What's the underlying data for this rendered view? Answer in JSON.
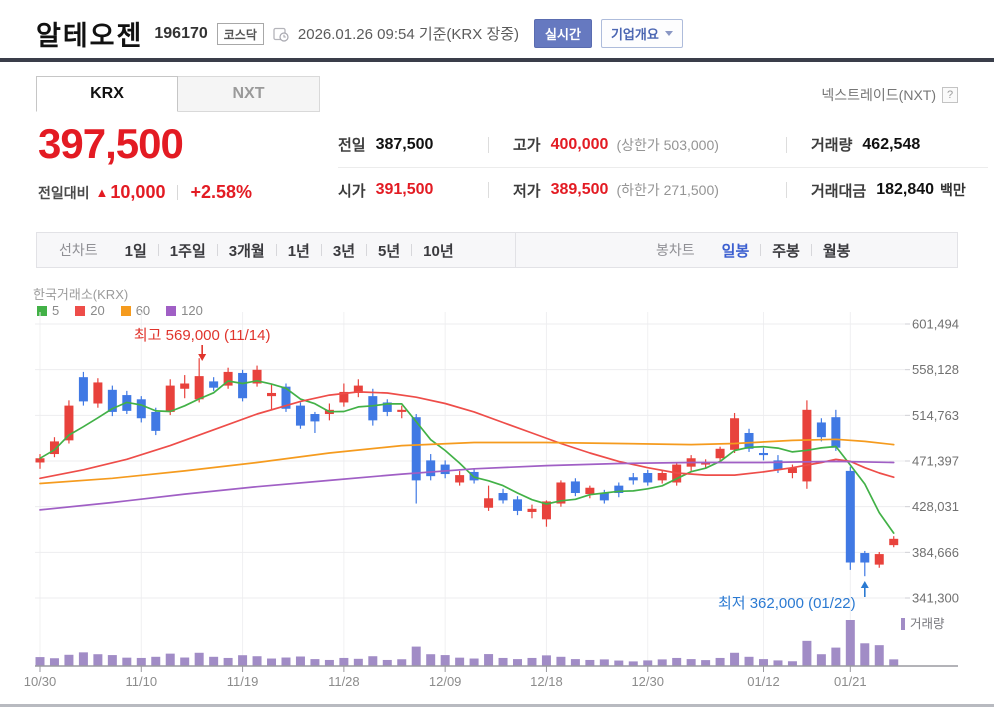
{
  "header": {
    "title": "알테오젠",
    "code": "196170",
    "market_badge": "코스닥",
    "datetime_note": "2026.01.26 09:54 기준(KRX 장중)",
    "realtime_button": "실시간",
    "company_overview_button": "기업개요",
    "nxt_link": "넥스트레이드(NXT)",
    "help_icon": "?"
  },
  "tabs": [
    {
      "label": "KRX",
      "active": true
    },
    {
      "label": "NXT",
      "active": false
    }
  ],
  "price": {
    "current": "397,500",
    "change_label": "전일대비",
    "change_direction": "up",
    "change_triangle": "▲",
    "change_value": "10,000",
    "change_percent": "+2.58%"
  },
  "info": {
    "prev_label": "전일",
    "prev": "387,500",
    "high_label": "고가",
    "high": "400,000",
    "upper_limit": "(상한가 503,000)",
    "volume_label": "거래량",
    "volume": "462,548",
    "open_label": "시가",
    "open": "391,500",
    "low_label": "저가",
    "low": "389,500",
    "lower_limit": "(하한가 271,500)",
    "value_label": "거래대금",
    "value": "182,840",
    "value_unit": "백만"
  },
  "toolbar": {
    "line_label": "선차트",
    "line_periods": [
      "1일",
      "1주일",
      "3개월",
      "1년",
      "3년",
      "5년",
      "10년"
    ],
    "candle_label": "봉차트",
    "candle_periods": [
      "일봉",
      "주봉",
      "월봉"
    ],
    "candle_active": "일봉"
  },
  "chart_data": {
    "type": "candlestick",
    "title": "한국거래소(KRX)",
    "price_unit_krw": 1000,
    "volume_unit_shares": 1000,
    "legend": [
      {
        "label": "5",
        "color": "#42b147"
      },
      {
        "label": "20",
        "color": "#ee4d49"
      },
      {
        "label": "60",
        "color": "#f59b1e"
      },
      {
        "label": "120",
        "color": "#a05fc5"
      }
    ],
    "volume_legend": "거래량",
    "y_ticks": [
      601494,
      558128,
      514763,
      471397,
      428031,
      384666,
      341300
    ],
    "x_ticks": [
      {
        "i": 0,
        "label": "10/30"
      },
      {
        "i": 7,
        "label": "11/10"
      },
      {
        "i": 14,
        "label": "11/19"
      },
      {
        "i": 21,
        "label": "11/28"
      },
      {
        "i": 28,
        "label": "12/09"
      },
      {
        "i": 35,
        "label": "12/18"
      },
      {
        "i": 42,
        "label": "12/30"
      },
      {
        "i": 50,
        "label": "01/12"
      },
      {
        "i": 56,
        "label": "01/21"
      }
    ],
    "annotations": {
      "high": {
        "text": "최고 569,000 (11/14)",
        "index": 11,
        "color": "#e0342c"
      },
      "low": {
        "text": "최저 362,000 (01/22)",
        "index": 57,
        "color": "#2b7ad2"
      }
    },
    "colors": {
      "up": "#e8423c",
      "down": "#4079e4",
      "volume": "#a18cc6",
      "grid": "#ededef",
      "axis_text": "#707070",
      "x_text": "#8c8c8c"
    },
    "candles": [
      [
        "10/30",
        470,
        478,
        464,
        474,
        620
      ],
      [
        "10/31",
        478,
        494,
        475,
        490,
        540
      ],
      [
        "11/03",
        491,
        529,
        488,
        524,
        780
      ],
      [
        "11/04",
        551,
        556,
        524,
        528,
        950
      ],
      [
        "11/05",
        526,
        550,
        522,
        546,
        820
      ],
      [
        "11/06",
        539,
        543,
        514,
        518,
        760
      ],
      [
        "11/07",
        534,
        538,
        516,
        519,
        580
      ],
      [
        "11/10",
        530,
        533,
        508,
        512,
        560
      ],
      [
        "11/11",
        518,
        522,
        496,
        500,
        640
      ],
      [
        "11/12",
        518,
        549,
        515,
        543,
        860
      ],
      [
        "11/13",
        540,
        553,
        531,
        545,
        590
      ],
      [
        "11/14",
        530,
        569,
        527,
        552,
        920
      ],
      [
        "11/17",
        547,
        551,
        538,
        541,
        640
      ],
      [
        "11/18",
        543,
        560,
        540,
        556,
        560
      ],
      [
        "11/19",
        555,
        558,
        528,
        531,
        750
      ],
      [
        "11/20",
        545,
        562,
        542,
        558,
        680
      ],
      [
        "11/21",
        533,
        545,
        520,
        536,
        520
      ],
      [
        "11/24",
        542,
        545,
        518,
        521,
        590
      ],
      [
        "11/25",
        524,
        527,
        502,
        505,
        660
      ],
      [
        "11/26",
        516,
        518,
        498,
        509,
        480
      ],
      [
        "11/27",
        516,
        526,
        510,
        520,
        420
      ],
      [
        "11/28",
        527,
        545,
        523,
        537,
        560
      ],
      [
        "12/01",
        536,
        549,
        532,
        543,
        500
      ],
      [
        "12/02",
        533,
        540,
        505,
        510,
        680
      ],
      [
        "12/03",
        527,
        530,
        514,
        518,
        420
      ],
      [
        "12/04",
        518,
        524,
        512,
        520,
        470
      ],
      [
        "12/05",
        513,
        516,
        431,
        453,
        1350
      ],
      [
        "12/08",
        472,
        478,
        453,
        457,
        820
      ],
      [
        "12/09",
        468,
        472,
        455,
        459,
        760
      ],
      [
        "12/10",
        451,
        462,
        448,
        458,
        580
      ],
      [
        "12/11",
        461,
        464,
        450,
        453,
        520
      ],
      [
        "12/12",
        427,
        448,
        424,
        436,
        830
      ],
      [
        "12/15",
        441,
        445,
        431,
        434,
        560
      ],
      [
        "12/16",
        435,
        438,
        420,
        424,
        480
      ],
      [
        "12/17",
        423,
        430,
        417,
        426,
        560
      ],
      [
        "12/18",
        416,
        434,
        409,
        433,
        740
      ],
      [
        "12/19",
        431,
        453,
        428,
        451,
        640
      ],
      [
        "12/22",
        452,
        455,
        438,
        441,
        480
      ],
      [
        "12/23",
        440,
        448,
        436,
        446,
        420
      ],
      [
        "12/24",
        441,
        444,
        431,
        434,
        460
      ],
      [
        "12/26",
        448,
        451,
        437,
        441,
        380
      ],
      [
        "12/29",
        456,
        460,
        449,
        453,
        320
      ],
      [
        "12/30",
        460,
        463,
        448,
        451,
        390
      ],
      [
        "12/31",
        453,
        462,
        450,
        460,
        460
      ],
      [
        "01/02",
        451,
        470,
        448,
        468,
        560
      ],
      [
        "01/05",
        466,
        477,
        462,
        474,
        480
      ],
      [
        "01/06",
        468,
        473,
        464,
        470,
        410
      ],
      [
        "01/07",
        474,
        485,
        471,
        483,
        560
      ],
      [
        "01/08",
        482,
        517,
        479,
        512,
        920
      ],
      [
        "01/09",
        498,
        502,
        480,
        483,
        640
      ],
      [
        "01/12",
        479,
        484,
        472,
        477,
        480
      ],
      [
        "01/13",
        472,
        477,
        460,
        463,
        390
      ],
      [
        "01/14",
        460,
        468,
        455,
        465,
        330
      ],
      [
        "01/15",
        452,
        529,
        445,
        520,
        1750
      ],
      [
        "01/16",
        508,
        512,
        490,
        494,
        820
      ],
      [
        "01/19",
        513,
        520,
        481,
        484,
        1280
      ],
      [
        "01/21",
        462,
        466,
        368,
        375,
        3200
      ],
      [
        "01/22",
        384,
        386,
        362,
        375,
        1580
      ],
      [
        "01/23",
        373,
        385,
        370,
        383,
        1450
      ],
      [
        "01/26",
        391.5,
        400,
        389.5,
        397.5,
        463
      ]
    ],
    "ma_lines": [
      {
        "period": 5,
        "color": "#42b147",
        "source": "close_avg"
      },
      {
        "period": 20,
        "color": "#ee4d49",
        "points": [
          [
            0,
            455
          ],
          [
            3,
            463
          ],
          [
            6,
            473
          ],
          [
            9,
            486
          ],
          [
            12,
            501
          ],
          [
            15,
            516
          ],
          [
            18,
            528
          ],
          [
            20,
            534
          ],
          [
            22,
            537
          ],
          [
            24,
            536
          ],
          [
            26,
            532
          ],
          [
            28,
            526
          ],
          [
            30,
            518
          ],
          [
            32,
            508
          ],
          [
            34,
            498
          ],
          [
            36,
            488
          ],
          [
            38,
            479
          ],
          [
            40,
            471
          ],
          [
            42,
            465
          ],
          [
            44,
            460
          ],
          [
            46,
            458
          ],
          [
            48,
            458
          ],
          [
            50,
            461
          ],
          [
            52,
            465
          ],
          [
            54,
            470
          ],
          [
            55,
            473
          ],
          [
            56,
            471
          ],
          [
            57,
            465
          ],
          [
            58,
            460
          ],
          [
            59,
            456
          ]
        ]
      },
      {
        "period": 60,
        "color": "#f59b1e",
        "points": [
          [
            0,
            450
          ],
          [
            5,
            455
          ],
          [
            10,
            462
          ],
          [
            15,
            470
          ],
          [
            20,
            479
          ],
          [
            25,
            486
          ],
          [
            30,
            489
          ],
          [
            35,
            489
          ],
          [
            40,
            488
          ],
          [
            45,
            487
          ],
          [
            48,
            488
          ],
          [
            52,
            491
          ],
          [
            55,
            492
          ],
          [
            57,
            490
          ],
          [
            59,
            487
          ]
        ]
      },
      {
        "period": 120,
        "color": "#a05fc5",
        "points": [
          [
            0,
            425
          ],
          [
            5,
            432
          ],
          [
            10,
            440
          ],
          [
            15,
            447
          ],
          [
            20,
            453
          ],
          [
            25,
            459
          ],
          [
            30,
            464
          ],
          [
            35,
            467
          ],
          [
            40,
            469
          ],
          [
            45,
            470
          ],
          [
            50,
            470
          ],
          [
            55,
            471
          ],
          [
            59,
            470
          ]
        ]
      }
    ]
  }
}
